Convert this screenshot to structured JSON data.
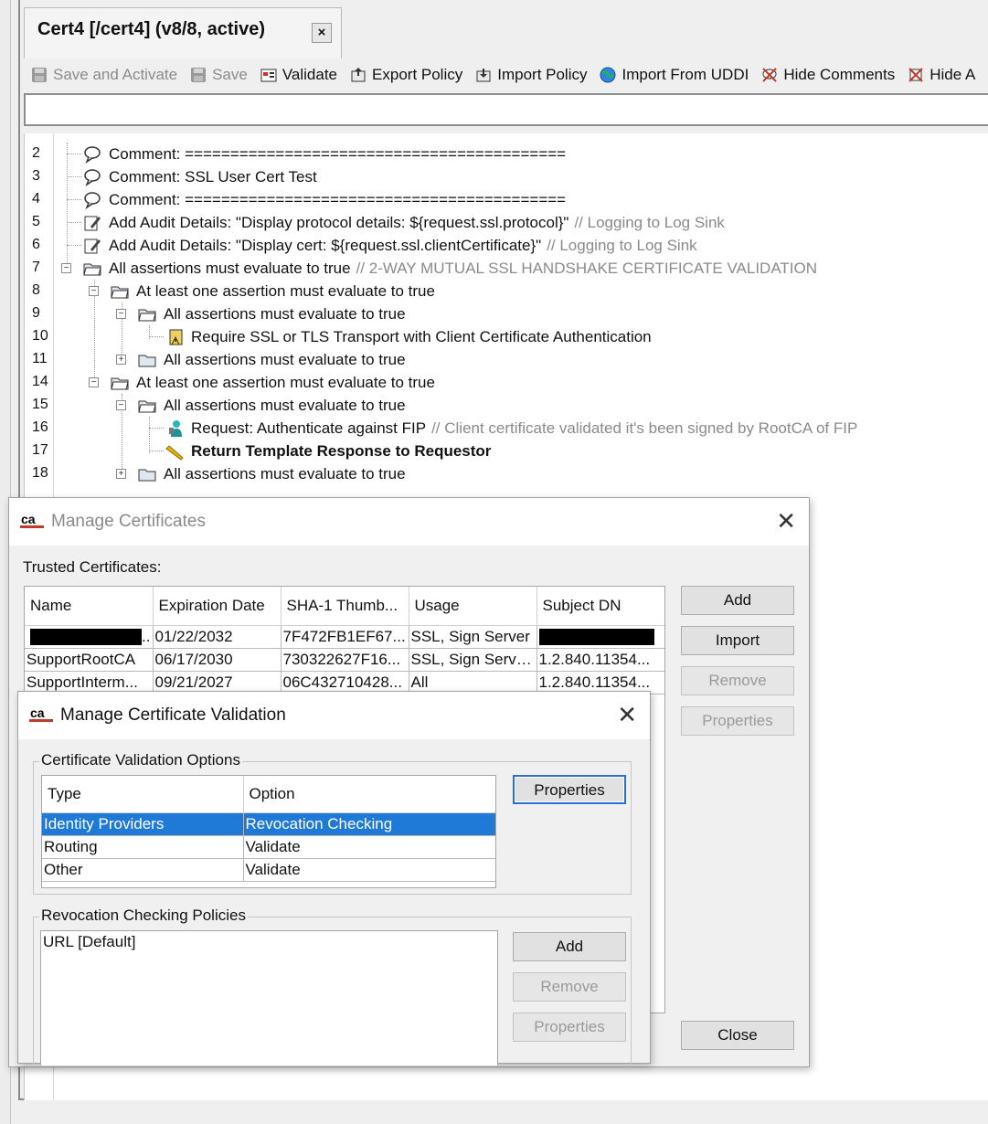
{
  "tab": {
    "title": "Cert4 [/cert4] (v8/8, active)",
    "close": "×"
  },
  "toolbar": [
    {
      "label": "Save and Activate",
      "icon": "save-icon",
      "disabled": true
    },
    {
      "label": "Save",
      "icon": "save-icon",
      "disabled": true
    },
    {
      "label": "Validate",
      "icon": "validate-icon",
      "disabled": false
    },
    {
      "label": "Export Policy",
      "icon": "export-icon",
      "disabled": false
    },
    {
      "label": "Import Policy",
      "icon": "import-icon",
      "disabled": false
    },
    {
      "label": "Import From UDDI",
      "icon": "globe-icon",
      "disabled": false
    },
    {
      "label": "Hide Comments",
      "icon": "hide-comments-icon",
      "disabled": false
    },
    {
      "label": "Hide A",
      "icon": "hide-assertions-icon",
      "disabled": false
    }
  ],
  "tree": [
    {
      "line": "2",
      "text": "Comment: ==========================================",
      "comment": ""
    },
    {
      "line": "3",
      "text": "Comment: SSL User Cert Test",
      "comment": ""
    },
    {
      "line": "4",
      "text": "Comment: ==========================================",
      "comment": ""
    },
    {
      "line": "5",
      "text": "Add Audit Details: \"Display protocol details: ${request.ssl.protocol}\"",
      "comment": "// Logging to Log Sink"
    },
    {
      "line": "6",
      "text": "Add Audit Details: \"Display cert: ${request.ssl.clientCertificate}\"",
      "comment": "// Logging to Log Sink"
    },
    {
      "line": "7",
      "text": "All assertions must evaluate to true",
      "comment": "// 2-WAY MUTUAL SSL HANDSHAKE CERTIFICATE VALIDATION"
    },
    {
      "line": "8",
      "text": "At least one assertion must evaluate to true",
      "comment": ""
    },
    {
      "line": "9",
      "text": "All assertions must evaluate to true",
      "comment": ""
    },
    {
      "line": "10",
      "text": "Require SSL or TLS Transport with Client Certificate Authentication",
      "comment": ""
    },
    {
      "line": "11",
      "text": "All assertions must evaluate to true",
      "comment": ""
    },
    {
      "line": "14",
      "text": "At least one assertion must evaluate to true",
      "comment": ""
    },
    {
      "line": "15",
      "text": "All assertions must evaluate to true",
      "comment": ""
    },
    {
      "line": "16",
      "text": "Request: Authenticate against FIP",
      "comment": "// Client certificate validated it's been signed by RootCA of FIP"
    },
    {
      "line": "17",
      "text": "Return Template Response to Requestor",
      "comment": ""
    },
    {
      "line": "18",
      "text": "All assertions must evaluate to true",
      "comment": ""
    }
  ],
  "manage_certs": {
    "title": "Manage Certificates",
    "trusted_label": "Trusted Certificates:",
    "columns": [
      "Name",
      "Expiration Date",
      "SHA-1 Thumb...",
      "Usage",
      "Subject DN"
    ],
    "rows": [
      [
        "..",
        "01/22/2032",
        "7F472FB1EF67...",
        "SSL, Sign Server",
        ""
      ],
      [
        "SupportRootCA",
        "06/17/2030",
        "730322627F16...",
        "SSL, Sign Serve...",
        "1.2.840.11354..."
      ],
      [
        "SupportInterm...",
        "09/21/2027",
        "06C432710428...",
        "All",
        "1.2.840.11354..."
      ]
    ],
    "buttons": {
      "add": "Add",
      "import": "Import",
      "remove": "Remove",
      "properties": "Properties",
      "close": "Close"
    }
  },
  "cert_validation": {
    "title": "Manage Certificate Validation",
    "options_label": "Certificate Validation Options",
    "columns": [
      "Type",
      "Option"
    ],
    "rows": [
      [
        "Identity Providers",
        "Revocation Checking"
      ],
      [
        "Routing",
        "Validate"
      ],
      [
        "Other",
        "Validate"
      ]
    ],
    "properties_button": "Properties",
    "policies_label": "Revocation Checking Policies",
    "policies": [
      "URL [Default]"
    ],
    "buttons": {
      "add": "Add",
      "remove": "Remove",
      "properties": "Properties"
    }
  },
  "colors": {
    "selection": "#1e7ad6",
    "focus": "#2b6fd6"
  }
}
